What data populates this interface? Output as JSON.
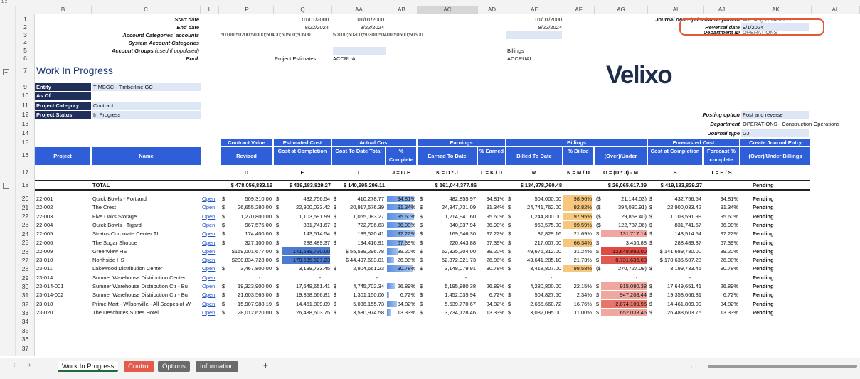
{
  "columns": [
    "B",
    "C",
    "L",
    "P",
    "Q",
    "AA",
    "AB",
    "AC",
    "AD",
    "AE",
    "AF",
    "AG",
    "AI",
    "AJ",
    "AK",
    "AL"
  ],
  "selected_column": "AC",
  "rows": [
    "1",
    "2",
    "3",
    "4",
    "5",
    "6",
    "7",
    "9",
    "10",
    "11",
    "12",
    "13",
    "14",
    "15",
    "16",
    "17",
    "18",
    "20",
    "21",
    "22",
    "23",
    "24",
    "25",
    "26",
    "27",
    "28",
    "29",
    "30",
    "31",
    "32",
    "33",
    "34",
    "35",
    "36",
    "37"
  ],
  "params": {
    "start_date": "Start date",
    "end_date": "End date",
    "acct_cat_accounts": "Account Categories' accounts",
    "sys_acct_cat": "System Account Categories",
    "acct_groups": "Account Groups",
    "acct_groups_note": "(used if populated)",
    "book": "Book",
    "q_date1": "01/01/2000",
    "q_date2": "8/22/2024",
    "q_accts": "50100;50200;50300;50400;50500;50600",
    "aa_date1": "01/01/2000",
    "aa_date2": "8/22/2024",
    "aa_accts": "50100;50200;50300;50400;50500;50600",
    "proj_est": "Project Estimates",
    "accrual1": "ACCRUAL",
    "ae_date1": "01/01/2000",
    "ae_date2": "8/22/2024",
    "billings": "Billings",
    "accrual2": "ACCRUAL",
    "journal_desc": "Journal description/name pattern",
    "journal_desc_val": "WIP Aug 2024-08-22",
    "reversal_date": "Reversal date",
    "reversal_val": "9/1/2024",
    "department_label": "Department ID",
    "department_val": "OPERATIONS"
  },
  "title": "Work In Progress",
  "logo": "Velixo",
  "filters": {
    "entity_label": "Entity",
    "entity_val": "TIMBGC - Timberline GC",
    "asof_label": "As Of",
    "asof_val": "",
    "cat_label": "Project Category",
    "cat_val": "Contract",
    "status_label": "Project Status",
    "status_val": "In Progress"
  },
  "posting": {
    "opt_label": "Posting option",
    "opt_val": "Post and reverse",
    "dept_label": "Department",
    "dept_val": "OPERATIONS - Construction Operations",
    "jt_label": "Journal type",
    "jt_val": "GJ"
  },
  "groups": [
    "Contract Value",
    "Estimated Cost",
    "Actual Cost",
    "Earnings",
    "Billings",
    "Forecasted Cost",
    "Create Journal Entry"
  ],
  "headers": [
    "Project",
    "Name",
    "Revised",
    "Cost at Completion",
    "Cost To Date Total",
    "% Complete",
    "Earned To Date",
    "% Earned",
    "Billed To Date",
    "% Billed",
    "(Over)/Under",
    "Cost at Completion",
    "Forecast % complete",
    "(Over)/Under Billings"
  ],
  "formulas": [
    "D",
    "E",
    "I",
    "J = I / E",
    "K = D * J",
    "L = K / D",
    "M",
    "N = M / D",
    "O = (D * J) - M",
    "S",
    "T = E / S"
  ],
  "total": {
    "label": "TOTAL",
    "p": "$ 478,056,833.19",
    "q": "$ 419,183,829.27",
    "aa": "$ 140,995,296.11",
    "ac": "$ 161,044,377.86",
    "ae": "$ 134,978,760.48",
    "ag": "$ 26,065,617.39",
    "ai": "$ 419,183,829.27",
    "ak": "Pending"
  },
  "projects": [
    {
      "id": "22-001",
      "name": "Quick Bowls - Portland",
      "open": "Open",
      "p": "509,310.00",
      "q": "432,756.54",
      "aa": "410,278.77",
      "ab": "94.81%",
      "ac": "482,855.97",
      "ad": "94.81%",
      "ae": "504,000.00",
      "af": "98.96%",
      "ag": "21,144.03)",
      "ai": "432,756.54",
      "aj": "94.81%",
      "ak": "Pending",
      "abf": 0.948,
      "afc": "#f7c77e",
      "agc": ""
    },
    {
      "id": "22-002",
      "name": "The Crest",
      "open": "Open",
      "p": "26,655,280.00",
      "q": "22,900,033.42",
      "aa": "20,917,576.39",
      "ab": "91.34%",
      "ac": "24,347,731.09",
      "ad": "91.34%",
      "ae": "24,741,762.00",
      "af": "92.82%",
      "ag": "394,030.91)",
      "ai": "22,900,033.42",
      "aj": "91.34%",
      "ak": "Pending",
      "abf": 0.913,
      "afc": "#f7c77e",
      "agc": ""
    },
    {
      "id": "22-003",
      "name": "Five Oaks Storage",
      "open": "Open",
      "p": "1,270,800.00",
      "q": "1,103,591.99",
      "aa": "1,055,083.27",
      "ab": "95.60%",
      "ac": "1,214,941.60",
      "ad": "95.60%",
      "ae": "1,244,800.00",
      "af": "97.95%",
      "ag": "29,858.40)",
      "ai": "1,103,591.99",
      "aj": "95.60%",
      "ak": "Pending",
      "abf": 0.956,
      "afc": "#f7c77e",
      "agc": ""
    },
    {
      "id": "22-004",
      "name": "Quick Bowls - Tigard",
      "open": "Open",
      "p": "967,575.00",
      "q": "831,741.67",
      "aa": "722,796.63",
      "ab": "86.90%",
      "ac": "840,837.94",
      "ad": "86.90%",
      "ae": "963,575.00",
      "af": "99.59%",
      "ag": "122,737.06)",
      "ai": "831,741.67",
      "aj": "86.90%",
      "ak": "Pending",
      "abf": 0.869,
      "afc": "#f7c77e",
      "agc": ""
    },
    {
      "id": "22-005",
      "name": "Stratus Corporate Center TI",
      "open": "Open",
      "p": "174,400.00",
      "q": "143,514.54",
      "aa": "139,520.41",
      "ab": "97.22%",
      "ac": "169,546.30",
      "ad": "97.22%",
      "ae": "37,829.16",
      "af": "21.69%",
      "ag": "131,717.14",
      "ai": "143,514.54",
      "aj": "97.22%",
      "ak": "Pending",
      "abf": 0.972,
      "afc": "",
      "agc": "#f0a7a0"
    },
    {
      "id": "22-006",
      "name": "The Sugar Shoppe",
      "open": "Open",
      "p": "327,100.00",
      "q": "288,489.37",
      "aa": "194,416.91",
      "ab": "67.39%",
      "ac": "220,443.88",
      "ad": "67.39%",
      "ae": "217,007.00",
      "af": "66.34%",
      "ag": "3,436.88",
      "ai": "288,489.37",
      "aj": "67.39%",
      "ak": "Pending",
      "abf": 0.674,
      "afc": "#f7c77e",
      "agc": ""
    },
    {
      "id": "22-009",
      "name": "Greenview HS",
      "open": "Open",
      "p": "$159,001,677.00",
      "q": "141,689,730.00",
      "aa": "$ 55,539,296.78",
      "ab": "39.20%",
      "ac": "62,325,204.00",
      "ad": "39.20%",
      "ae": "49,676,312.00",
      "af": "31.24%",
      "ag": "12,648,892.00",
      "ai": "$ 141,689,730.00",
      "aj": "39.20%",
      "ak": "Pending",
      "abf": 0.392,
      "afc": "",
      "agc": "#e04b44",
      "qhi": true
    },
    {
      "id": "23-010",
      "name": "Northside HS",
      "open": "Open",
      "p": "$200,834,728.00",
      "q": "170,635,507.23",
      "aa": "$ 44,497,683.01",
      "ab": "26.08%",
      "ac": "52,372,921.73",
      "ad": "26.08%",
      "ae": "43,641,285.10",
      "af": "21.73%",
      "ag": "8,731,636.63",
      "ai": "$ 170,635,507.23",
      "aj": "26.08%",
      "ak": "Pending",
      "abf": 0.261,
      "afc": "",
      "agc": "#e05a50",
      "qhi": true
    },
    {
      "id": "23-011",
      "name": "Lakewood Distribution Center",
      "open": "Open",
      "p": "3,467,800.00",
      "q": "3,199,733.45",
      "aa": "2,904,661.23",
      "ab": "90.78%",
      "ac": "3,148,079.91",
      "ad": "90.78%",
      "ae": "3,418,807.00",
      "af": "98.58%",
      "ag": "270,727.09)",
      "ai": "3,199,733.45",
      "aj": "90.78%",
      "ak": "Pending",
      "abf": 0.908,
      "afc": "#f7c77e",
      "agc": ""
    },
    {
      "id": "23-014",
      "name": "Sumner Warehouse Distribution Center",
      "open": "Open",
      "p": "",
      "q": "",
      "aa": "",
      "ab": "",
      "ac": "",
      "ad": "",
      "ae": "",
      "af": "",
      "ag": "",
      "ai": "",
      "aj": "",
      "ak": "Pending",
      "abf": 0,
      "afc": "",
      "agc": ""
    },
    {
      "id": "23-014-001",
      "name": "Sumner Warehouse Distribution Ctr - Bu",
      "open": "Open",
      "p": "19,323,900.00",
      "q": "17,649,651.41",
      "aa": "4,745,702.34",
      "ab": "26.89%",
      "ac": "5,195,880.38",
      "ad": "26.89%",
      "ae": "4,280,800.00",
      "af": "22.15%",
      "ag": "915,080.38",
      "ai": "17,649,651.41",
      "aj": "26.89%",
      "ak": "Pending",
      "abf": 0.269,
      "afc": "",
      "agc": "#f0a7a0"
    },
    {
      "id": "23-014-002",
      "name": "Sumner Warehouse Distribution Ctr - Bu",
      "open": "Open",
      "p": "21,603,565.00",
      "q": "19,358,666.81",
      "aa": "1,301,150.06",
      "ab": "6.72%",
      "ac": "1,452,035.94",
      "ad": "6.72%",
      "ae": "504,827.50",
      "af": "2.34%",
      "ag": "947,208.44",
      "ai": "19,358,666.81",
      "aj": "6.72%",
      "ak": "Pending",
      "abf": 0.067,
      "afc": "",
      "agc": "#f0a7a0"
    },
    {
      "id": "23-018",
      "name": "Prime Mart - Wilsonville - All Scopes of W",
      "open": "Open",
      "p": "15,907,988.19",
      "q": "14,461,809.09",
      "aa": "5,036,155.73",
      "ab": "34.82%",
      "ac": "5,539,770.67",
      "ad": "34.82%",
      "ae": "2,665,660.72",
      "af": "16.76%",
      "ag": "2,874,109.95",
      "ai": "14,461,809.09",
      "aj": "34.82%",
      "ak": "Pending",
      "abf": 0.348,
      "afc": "",
      "agc": "#e8746a"
    },
    {
      "id": "23-020",
      "name": "The Deschutes Suites Hotel",
      "open": "Open",
      "p": "28,012,620.00",
      "q": "26,488,603.75",
      "aa": "3,530,974.58",
      "ab": "13.33%",
      "ac": "3,734,128.46",
      "ad": "13.33%",
      "ae": "3,082,095.00",
      "af": "11.00%",
      "ag": "652,033.46",
      "ai": "26,488,603.75",
      "aj": "13.33%",
      "ak": "Pending",
      "abf": 0.133,
      "afc": "",
      "agc": "#f0a7a0"
    }
  ],
  "sheet_tabs": [
    "Work In Progress",
    "Control",
    "Options",
    "Information"
  ],
  "add_sheet": "+"
}
